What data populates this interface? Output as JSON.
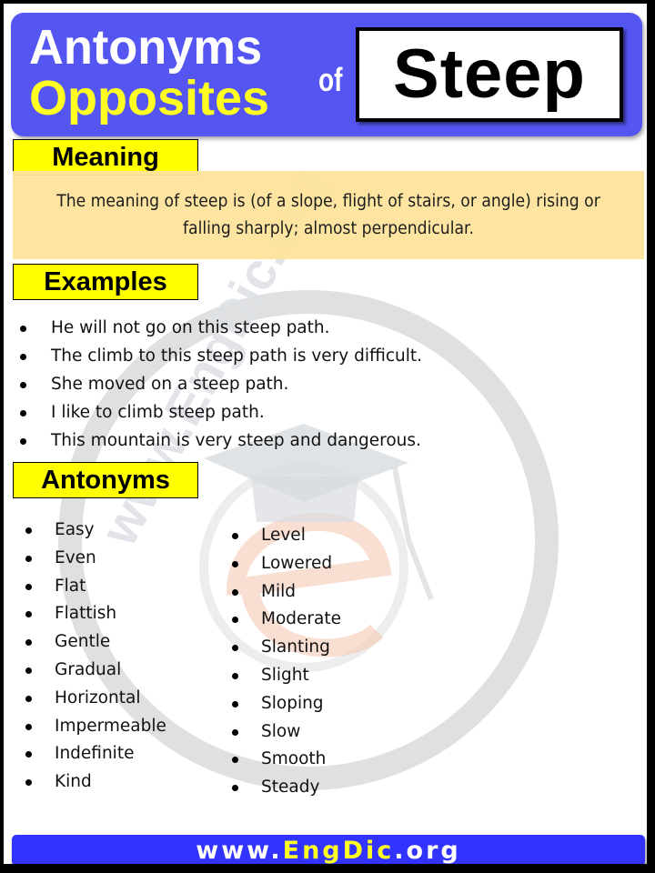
{
  "header": {
    "line1": "Antonyms",
    "line2": "Opposites",
    "connector": "of",
    "word": "Steep",
    "colors": {
      "banner": "#5555f2",
      "line1": "#ffffff",
      "line2": "#ffff22"
    }
  },
  "meaning": {
    "label": "Meaning",
    "text": "The meaning of steep is (of a slope, flight of stairs, or angle) rising or falling sharply; almost perpendicular."
  },
  "examples": {
    "label": "Examples",
    "items": [
      "He will not go on this steep path.",
      "The climb to this steep path is very difficult.",
      "She moved on a steep path.",
      "I like to climb steep path.",
      "This mountain is very steep and dangerous."
    ]
  },
  "antonyms": {
    "label": "Antonyms",
    "column1": [
      "Easy",
      "Even",
      "Flat",
      "Flattish",
      "Gentle",
      "Gradual",
      "Horizontal",
      "Impermeable",
      "Indefinite",
      "Kind"
    ],
    "column2": [
      "Level",
      "Lowered",
      "Mild",
      "Moderate",
      "Slanting",
      "Slight",
      "Sloping",
      "Slow",
      "Smooth",
      "Steady"
    ]
  },
  "footer": {
    "prefix": "www.",
    "brand": "EngDic",
    "suffix": ".org",
    "colors": {
      "bar": "#3333ff",
      "brand": "#ffff22"
    }
  },
  "watermark": {
    "text": "www.EngDic.org",
    "icon": "graduation-cap-e-logo"
  }
}
